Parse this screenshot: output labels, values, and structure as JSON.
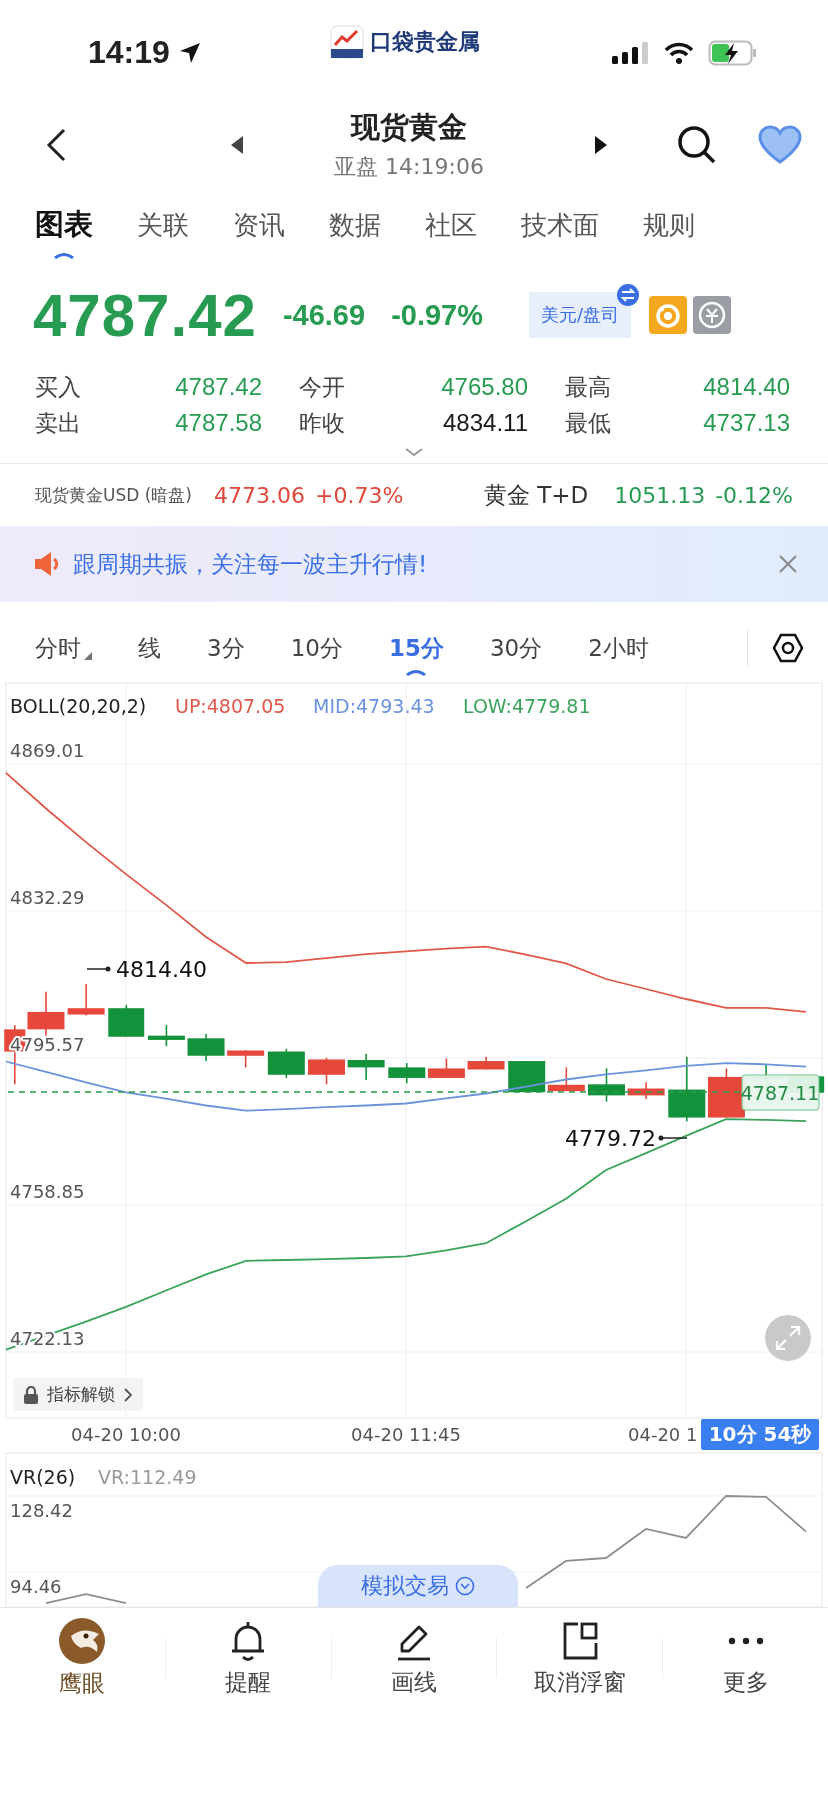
{
  "status_bar": {
    "time": "14:19"
  },
  "app_logo": {
    "text": "口袋贵金属"
  },
  "nav": {
    "title": "现货黄金",
    "subtitle": "亚盘 14:19:06",
    "favorited": true
  },
  "tabs": [
    {
      "label": "图表",
      "selected": true
    },
    {
      "label": "关联",
      "selected": false
    },
    {
      "label": "资讯",
      "selected": false
    },
    {
      "label": "数据",
      "selected": false
    },
    {
      "label": "社区",
      "selected": false
    },
    {
      "label": "技术面",
      "selected": false
    },
    {
      "label": "规则",
      "selected": false
    }
  ],
  "quote": {
    "price": "4787.42",
    "change": "-46.69",
    "change_pct": "-0.97%",
    "currency_button": "美元/盘司"
  },
  "stat_rows": [
    {
      "cells": [
        {
          "label": "买入",
          "value": "4787.42",
          "color": "#279b52"
        },
        {
          "label": "今开",
          "value": "4765.80",
          "color": "#279b52"
        },
        {
          "label": "最高",
          "value": "4814.40",
          "color": "#279b52"
        }
      ]
    },
    {
      "cells": [
        {
          "label": "卖出",
          "value": "4787.58",
          "color": "#279b52"
        },
        {
          "label": "昨收",
          "value": "4834.11",
          "color": "#1a1a1a"
        },
        {
          "label": "最低",
          "value": "4737.13",
          "color": "#279b52"
        }
      ]
    }
  ],
  "tickers": [
    {
      "kind": "compact",
      "name": "现货黄金USD (暗盘)",
      "price": "4773.06",
      "change": "+0.73%",
      "color": "#e0483c"
    },
    {
      "kind": "regular",
      "name": "黄金 T+D",
      "price": "1051.13",
      "change": "-0.12%",
      "color": "#279b52"
    }
  ],
  "banner": {
    "text": "跟周期共振，关注每一波主升行情!"
  },
  "periods": [
    {
      "label": "分时",
      "selected": false,
      "has_menu": true
    },
    {
      "label": "线",
      "selected": false,
      "has_menu": false
    },
    {
      "label": "3分",
      "selected": false,
      "has_menu": false
    },
    {
      "label": "10分",
      "selected": false,
      "has_menu": false
    },
    {
      "label": "15分",
      "selected": true,
      "has_menu": false
    },
    {
      "label": "30分",
      "selected": false,
      "has_menu": false
    },
    {
      "label": "2小时",
      "selected": false,
      "has_menu": false
    }
  ],
  "main_chart": {
    "indicator": "BOLL(20,20,2)",
    "high_marker": "4814.40",
    "low_marker": "4779.72",
    "last_price": "4787.11",
    "unlock_button": "指标解锁",
    "cut_time_label": "04-20 1",
    "countdown": "10分 54秒",
    "chart_data": {
      "type": "line",
      "categories": [
        null,
        null,
        null,
        "04-20 10:00",
        null,
        null,
        null,
        null,
        null,
        null,
        "04-20 11:45",
        null,
        null,
        null,
        null,
        null,
        null,
        null,
        null,
        null,
        null
      ],
      "ylim": [
        4705.64,
        4889.24
      ],
      "grid": true,
      "yticks": [
        {
          "value": 4869.01,
          "label": "4869.01"
        },
        {
          "value": 4832.29,
          "label": "4832.29"
        },
        {
          "value": 4795.57,
          "label": "4795.57"
        },
        {
          "value": 4758.85,
          "label": "4758.85"
        },
        {
          "value": 4722.13,
          "label": "4722.13"
        }
      ],
      "series": [
        {
          "name": "UP:4807.05",
          "color": "#e0584a",
          "values": [
            4866.8,
            4857.9,
            4849.5,
            4841.5,
            4833.8,
            4825.8,
            4819.3,
            4819.5,
            4820.5,
            4821.5,
            4822.2,
            4822.9,
            4823.4,
            4821.4,
            4819.2,
            4815.3,
            4812.8,
            4810.3,
            4808.1,
            4808.1,
            4807.1
          ]
        },
        {
          "name": "MID:4793.43",
          "color": "#6b93dc",
          "values": [
            4794.7,
            4792.1,
            4789.5,
            4787.0,
            4785.4,
            4783.7,
            4782.4,
            4782.8,
            4783.3,
            4783.7,
            4784.2,
            4785.5,
            4786.7,
            4788.4,
            4790.2,
            4791.5,
            4792.5,
            4793.6,
            4794.3,
            4794.0,
            4793.4
          ]
        },
        {
          "name": "LOW:4779.81",
          "color": "#3aa35a",
          "values": [
            4722.7,
            4726.2,
            4729.7,
            4733.4,
            4737.5,
            4741.5,
            4744.9,
            4745.1,
            4745.3,
            4745.6,
            4746.0,
            4747.5,
            4749.3,
            4754.8,
            4760.4,
            4767.6,
            4771.8,
            4776.1,
            4780.3,
            4780.1,
            4779.8
          ]
        }
      ]
    }
  },
  "vr_chart": {
    "indicator": "VR(26)",
    "chart_data": {
      "type": "line",
      "categories": [
        null,
        null,
        null,
        null,
        null,
        null,
        null,
        null,
        null,
        null,
        null,
        null,
        null,
        null,
        null,
        null,
        null,
        null,
        null,
        null,
        null
      ],
      "ylim": [
        78.82,
        147.63
      ],
      "yticks": [
        {
          "value": 128.42,
          "label": "128.42"
        },
        {
          "value": 94.46,
          "label": "94.46"
        }
      ],
      "series": [
        {
          "name": "VR:112.49",
          "color": "#8a8f94",
          "values": [
            null,
            80.5,
            84.6,
            80.5,
            null,
            null,
            null,
            null,
            null,
            null,
            null,
            null,
            null,
            87.3,
            99.4,
            100.7,
            113.7,
            109.7,
            128.4,
            128.0,
            112.5
          ]
        }
      ]
    }
  },
  "sim_trade": {
    "label": "模拟交易"
  },
  "toolbar": [
    {
      "kind": "eagle",
      "label": "鹰眼"
    },
    {
      "kind": "bell",
      "label": "提醒"
    },
    {
      "kind": "pencil",
      "label": "画线"
    },
    {
      "kind": "window",
      "label": "取消浮窗"
    },
    {
      "kind": "more",
      "label": "更多"
    }
  ]
}
